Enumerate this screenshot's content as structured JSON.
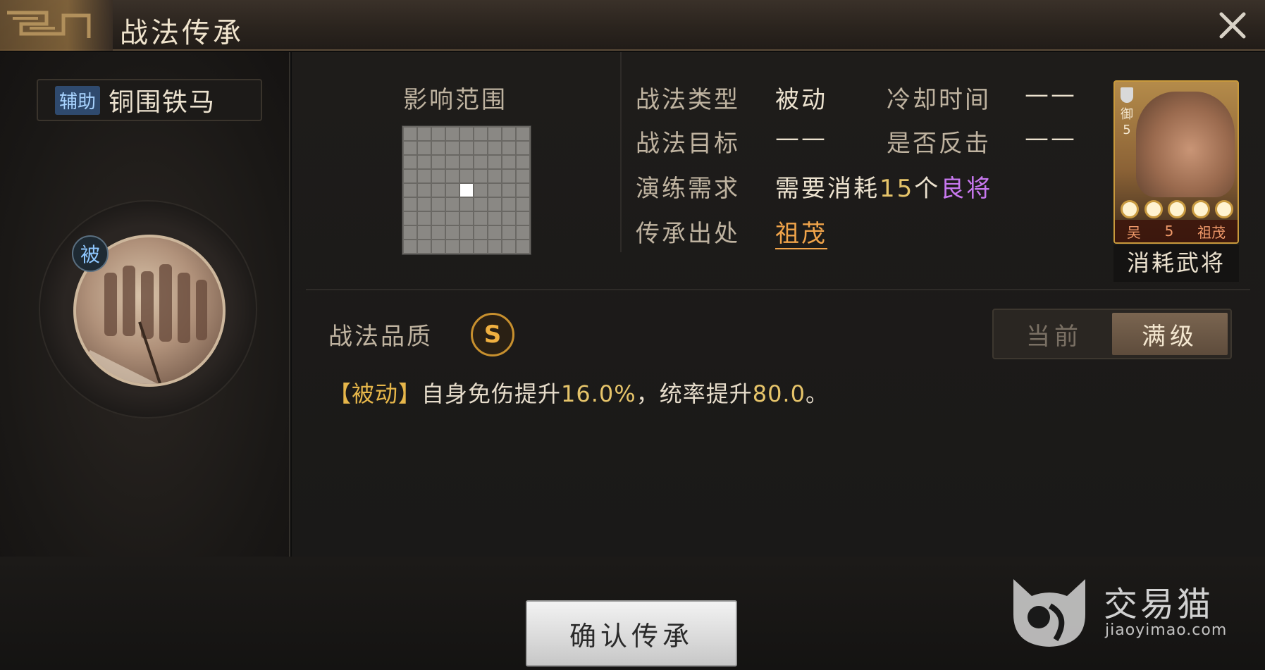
{
  "header": {
    "title": "战法传承",
    "close_icon": "close-icon"
  },
  "skill": {
    "tag": "辅助",
    "name": "铜围铁马",
    "badge": "被"
  },
  "range": {
    "label": "影响范围",
    "grid_size": 9,
    "center_index": 40
  },
  "info": {
    "type_label": "战法类型",
    "type_value": "被动",
    "cooldown_label": "冷却时间",
    "cooldown_value": "——",
    "target_label": "战法目标",
    "target_value": "——",
    "counter_label": "是否反击",
    "counter_value": "——",
    "train_label": "演练需求",
    "train_value_prefix": "需要消耗",
    "train_count": "15",
    "train_unit": "个",
    "train_grade": "良将",
    "origin_label": "传承出处",
    "origin_value": "祖茂"
  },
  "card": {
    "type": "御",
    "cost": "5",
    "faction": "吴",
    "level": "5",
    "name": "祖茂",
    "stars": 5,
    "caption": "消耗武将"
  },
  "quality": {
    "label": "战法品质",
    "grade": "S"
  },
  "level_tabs": [
    {
      "label": "当前",
      "active": false
    },
    {
      "label": "满级",
      "active": true
    }
  ],
  "description": {
    "tag": "【被动】",
    "part1": "自身免伤提升",
    "value1": "16.0%",
    "part2": "，统率提升",
    "value2": "80.0",
    "end": "。"
  },
  "footer": {
    "confirm_label": "确认传承",
    "watermark_name": "交易猫",
    "watermark_url": "jiaoyimao.com"
  },
  "colors": {
    "accent_gold": "#e6c46a",
    "grade_purple": "#c878f0",
    "link_orange": "#f0a44a"
  }
}
